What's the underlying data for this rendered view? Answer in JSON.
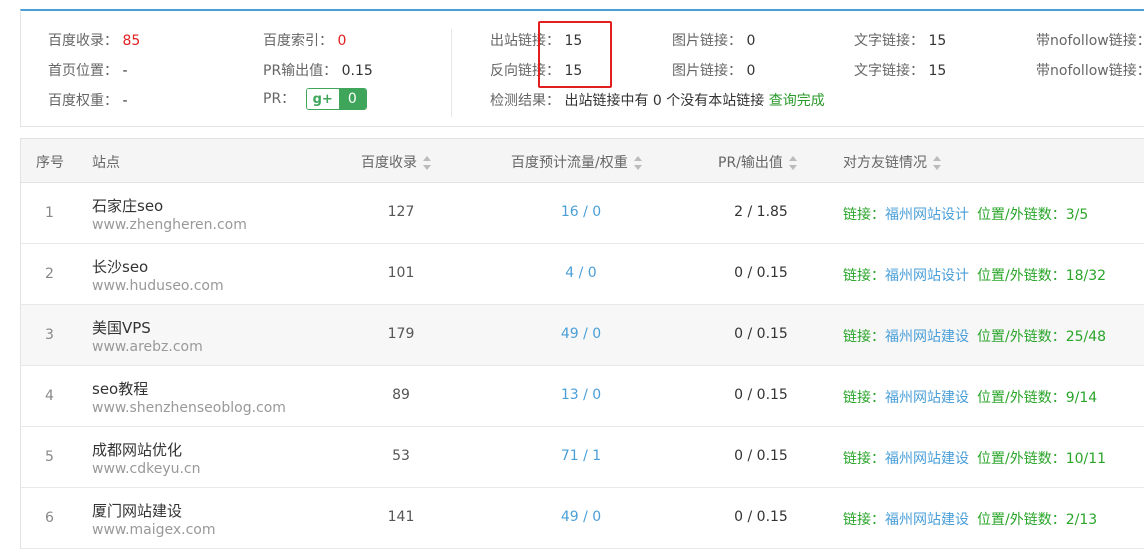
{
  "summary": {
    "baidu_shoulu_label": "百度收录：",
    "baidu_shoulu_value": "85",
    "baidu_suoyin_label": "百度索引：",
    "baidu_suoyin_value": "0",
    "chuzhan_label": "出站链接：",
    "chuzhan_value": "15",
    "tupian1_label": "图片链接：",
    "tupian1_value": "0",
    "wenzi1_label": "文字链接：",
    "wenzi1_value": "15",
    "nofollow1_label": "带nofollow链接：",
    "shouye_label": "首页位置：",
    "shouye_value": "-",
    "pr_out_label": "PR输出值：",
    "pr_out_value": "0.15",
    "fanxiang_label": "反向链接：",
    "fanxiang_value": "15",
    "tupian2_label": "图片链接：",
    "tupian2_value": "0",
    "wenzi2_label": "文字链接：",
    "wenzi2_value": "15",
    "nofollow2_label": "带nofollow链接：",
    "quanzhong_label": "百度权重：",
    "quanzhong_value": "-",
    "pr_label": "PR：",
    "pr_badge_g": "g+",
    "pr_badge_value": "0",
    "check_label": "检测结果：",
    "check_text": "出站链接中有 0 个没有本站链接",
    "check_status": "查询完成"
  },
  "table": {
    "headers": {
      "index": "序号",
      "site": "站点",
      "shoulu": "百度收录",
      "flow": "百度预计流量/权重",
      "pr": "PR/输出值",
      "friend": "对方友链情况"
    },
    "rows": [
      {
        "idx": "1",
        "name": "石家庄seo",
        "domain": "www.zhengheren.com",
        "shoulu": "127",
        "flow": "16 / 0",
        "pr": "2 / 1.85",
        "link_label": "链接：",
        "link_text": "福州网站设计",
        "pos": "位置/外链数：3/5"
      },
      {
        "idx": "2",
        "name": "长沙seo",
        "domain": "www.huduseo.com",
        "shoulu": "101",
        "flow": "4 / 0",
        "pr": "0 / 0.15",
        "link_label": "链接：",
        "link_text": "福州网站设计",
        "pos": "位置/外链数：18/32"
      },
      {
        "idx": "3",
        "name": "美国VPS",
        "domain": "www.arebz.com",
        "shoulu": "179",
        "flow": "49 / 0",
        "pr": "0 / 0.15",
        "link_label": "链接：",
        "link_text": "福州网站建设",
        "pos": "位置/外链数：25/48"
      },
      {
        "idx": "4",
        "name": "seo教程",
        "domain": "www.shenzhenseoblog.com",
        "shoulu": "89",
        "flow": "13 / 0",
        "pr": "0 / 0.15",
        "link_label": "链接：",
        "link_text": "福州网站建设",
        "pos": "位置/外链数：9/14"
      },
      {
        "idx": "5",
        "name": "成都网站优化",
        "domain": "www.cdkeyu.cn",
        "shoulu": "53",
        "flow": "71 / 1",
        "pr": "0 / 0.15",
        "link_label": "链接：",
        "link_text": "福州网站建设",
        "pos": "位置/外链数：10/11"
      },
      {
        "idx": "6",
        "name": "厦门网站建设",
        "domain": "www.maigex.com",
        "shoulu": "141",
        "flow": "49 / 0",
        "pr": "0 / 0.15",
        "link_label": "链接：",
        "link_text": "福州网站建设",
        "pos": "位置/外链数：2/13"
      }
    ]
  },
  "colors": {
    "accent_blue": "#4a9fd8",
    "green": "#2aa52a",
    "red": "#e02020",
    "highlight_box": "#e02020"
  }
}
